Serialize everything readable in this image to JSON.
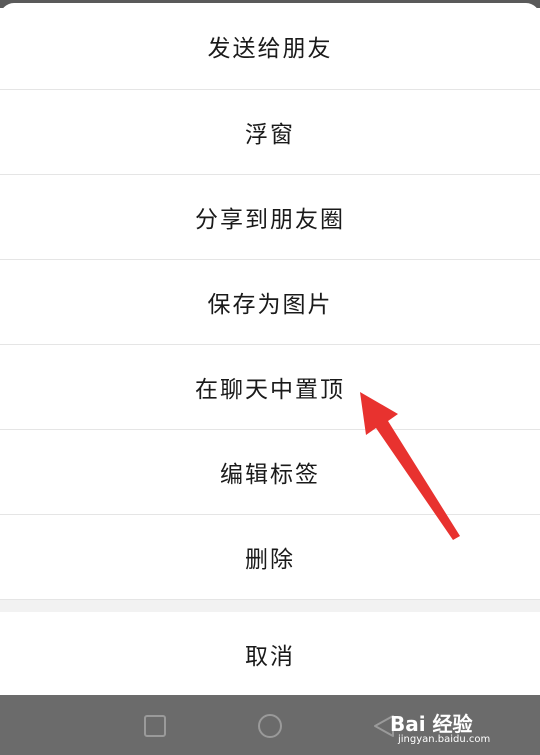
{
  "menu": {
    "items": [
      {
        "label": "发送给朋友"
      },
      {
        "label": "浮窗"
      },
      {
        "label": "分享到朋友圈"
      },
      {
        "label": "保存为图片"
      },
      {
        "label": "在聊天中置顶"
      },
      {
        "label": "编辑标签"
      },
      {
        "label": "删除"
      }
    ],
    "cancel_label": "取消"
  },
  "watermark": {
    "brand": "Bai 经验",
    "url": "jingyan.baidu.com"
  },
  "colors": {
    "annotation_arrow": "#e8322f",
    "navbar": "#6b6b6b",
    "divider": "#e5e5e5"
  },
  "icons": {
    "nav_recents": "square-icon",
    "nav_home": "circle-icon",
    "nav_back": "triangle-back-icon",
    "annotation": "red-arrow-icon"
  }
}
